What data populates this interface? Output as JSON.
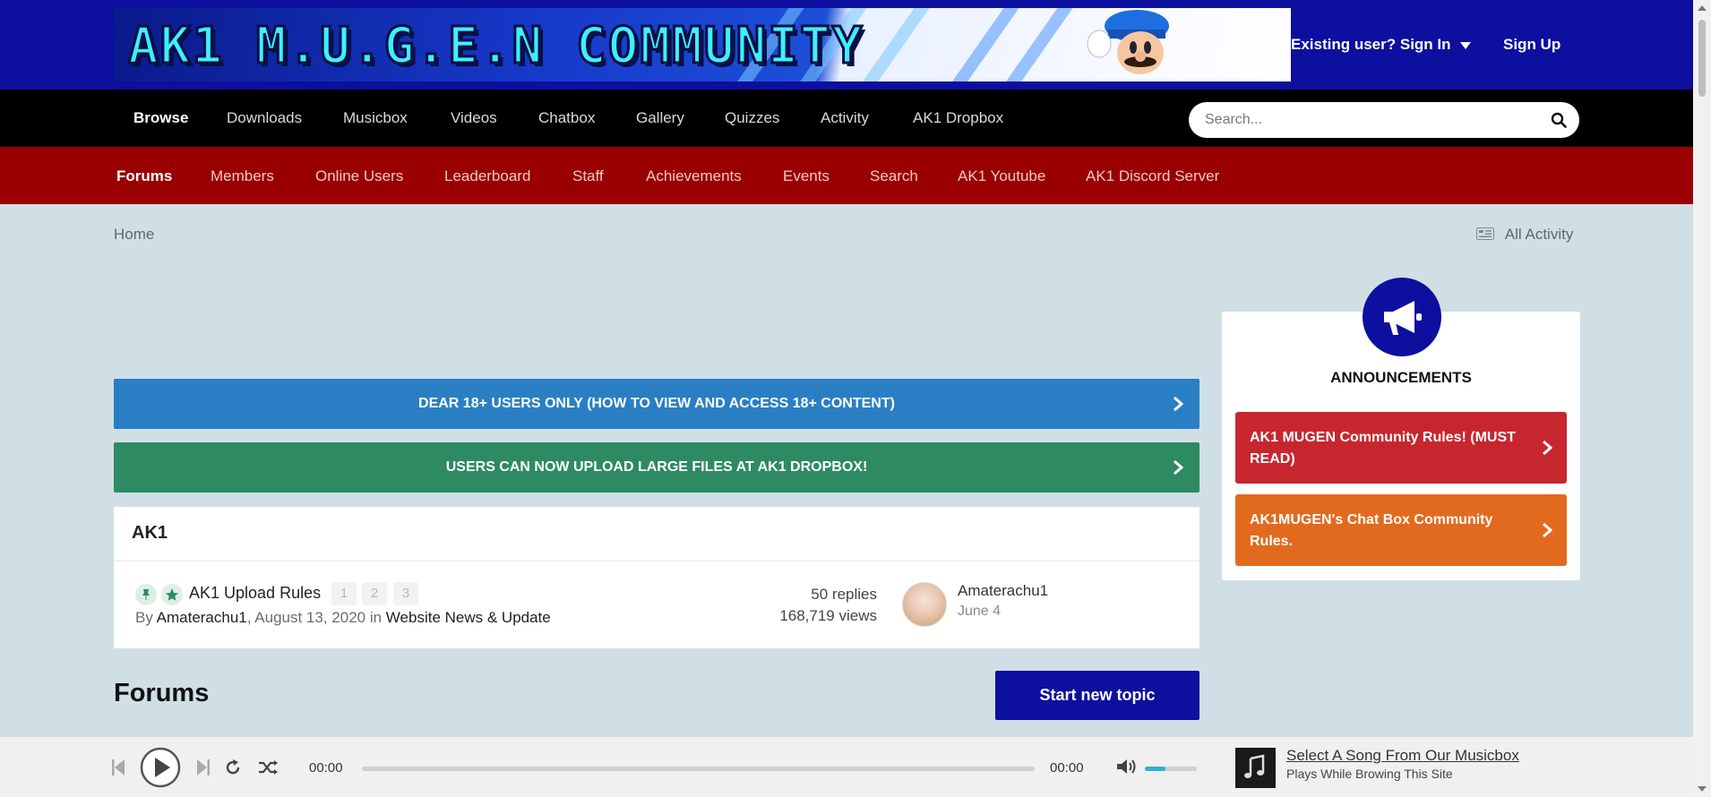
{
  "header": {
    "banner_text": "AK1 M.U.G.E.N COMMUNITY",
    "sign_in_label": "Existing user? Sign In",
    "sign_up_label": "Sign Up"
  },
  "primary_nav": {
    "items": [
      "Browse",
      "Downloads",
      "Musicbox",
      "Videos",
      "Chatbox",
      "Gallery",
      "Quizzes",
      "Activity",
      "AK1 Dropbox"
    ],
    "active": "Browse"
  },
  "search": {
    "placeholder": "Search..."
  },
  "secondary_nav": {
    "items": [
      "Forums",
      "Members",
      "Online Users",
      "Leaderboard",
      "Staff",
      "Achievements",
      "Events",
      "Search",
      "AK1 Youtube",
      "AK1 Discord Server"
    ],
    "active": "Forums"
  },
  "breadcrumb": {
    "home": "Home",
    "all_activity": "All Activity"
  },
  "notice_bars": [
    {
      "text": "DEAR 18+ USERS ONLY (HOW TO VIEW AND ACCESS 18+ CONTENT)",
      "color": "#2a7fc4"
    },
    {
      "text": "USERS CAN NOW UPLOAD LARGE FILES AT AK1 DROPBOX!",
      "color": "#2e8a63"
    }
  ],
  "pinned_panel": {
    "title": "AK1",
    "topic": {
      "title": "AK1 Upload Rules",
      "pages": [
        "1",
        "2",
        "3"
      ],
      "by_label": "By",
      "author": "Amaterachu1",
      "date": ", August 13, 2020 in",
      "forum": "Website News & Update",
      "replies": "50 replies",
      "views": "168,719 views",
      "last_poster": "Amaterachu1",
      "last_date": "June 4"
    }
  },
  "forums_section": {
    "heading": "Forums",
    "start_topic_label": "Start new topic"
  },
  "sidebar": {
    "title": "ANNOUNCEMENTS",
    "items": [
      {
        "text": "AK1 MUGEN Community Rules! (MUST READ)",
        "color": "#c8262e"
      },
      {
        "text": "AK1MUGEN's Chat Box Community Rules.",
        "color": "#e26a1f"
      }
    ]
  },
  "player": {
    "current_time": "00:00",
    "duration": "00:00",
    "progress": 0,
    "volume": 0.4,
    "song_title": "Select A Song From Our Musicbox",
    "song_subtitle": "Plays While Browing This Site"
  },
  "colors": {
    "header_bg": "#0d0f9e",
    "primary_nav_bg": "#000000",
    "secondary_nav_bg": "#9a0000",
    "page_bg": "#d0dfe5",
    "accent_button": "#0d0f9e",
    "volume_fill": "#2fb1d1"
  }
}
